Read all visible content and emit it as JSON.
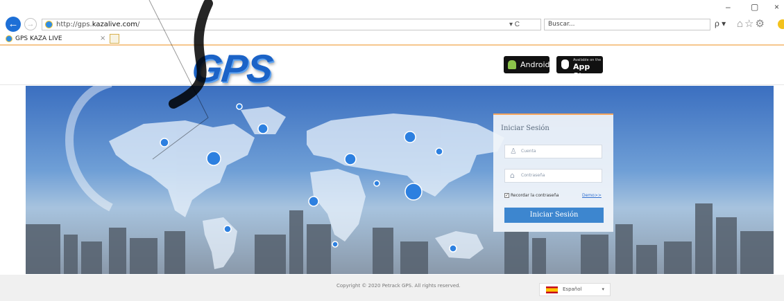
{
  "browser": {
    "url_prefix": "http://gps.",
    "url_domain": "kazalive.com",
    "url_suffix": "/",
    "search_placeholder": "Buscar...",
    "tab_title": "GPS KAZA LIVE",
    "tab_close": "×",
    "addr_tools": "▾ C",
    "search_btn": "ρ ▾",
    "minimize": "–",
    "restore": "▢",
    "close": "×",
    "toolbar_icons": "⌂☆⚙"
  },
  "header": {
    "logo_text": "GPS",
    "android_label": "Android",
    "appstore_small": "Available on the",
    "appstore_label": "App Store"
  },
  "login": {
    "title": "Iniciar Sesión",
    "account_placeholder": "Cuenta",
    "password_placeholder": "Contraseña",
    "remember_label": "Recordar la contraseña",
    "remember_checked": true,
    "remember_check": "✓",
    "demo_link": "Demo>>",
    "submit_label": "Iniciar Sesión"
  },
  "footer": {
    "copyright": "Copyright © 2020 Petrack GPS. All rights reserved.",
    "language": "Español",
    "caret": "▾"
  },
  "icons": {
    "back": "←",
    "forward": "→",
    "user_icon": "♙",
    "lock_icon": "⌂"
  },
  "colors": {
    "accent": "#3d86cf",
    "logo": "#1b63c7",
    "tab_line": "#f6c78d"
  }
}
